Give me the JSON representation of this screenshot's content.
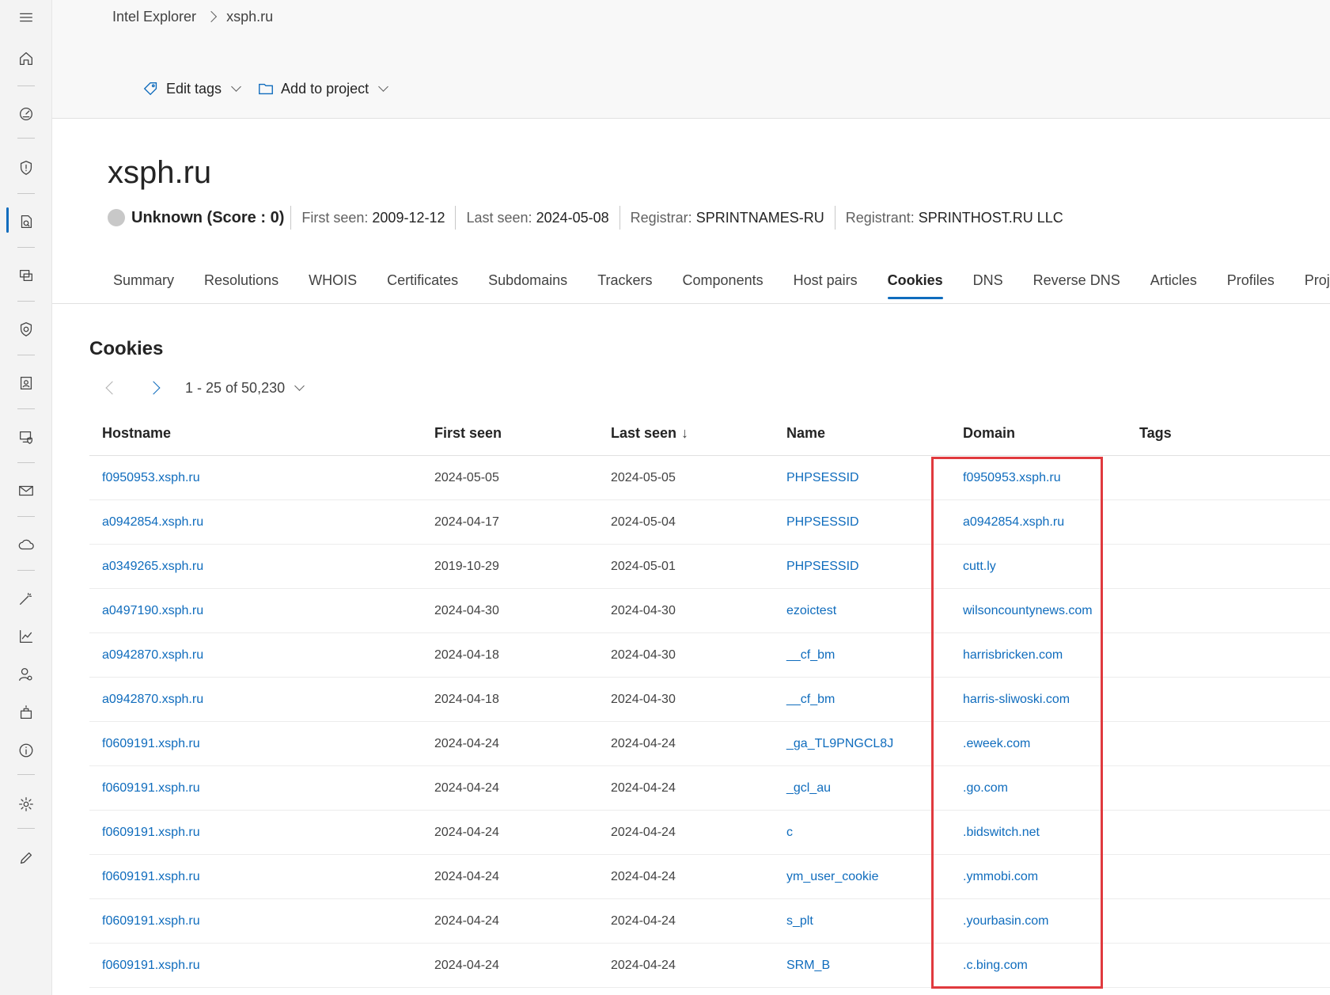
{
  "breadcrumb": {
    "root": "Intel Explorer",
    "current": "xsph.ru"
  },
  "toolbar": {
    "edit_tags": "Edit tags",
    "add_to_project": "Add to project"
  },
  "title": "xsph.ru",
  "meta": {
    "reputation": "Unknown (Score : 0)",
    "first_seen_label": "First seen:",
    "first_seen": "2009-12-12",
    "last_seen_label": "Last seen:",
    "last_seen": "2024-05-08",
    "registrar_label": "Registrar:",
    "registrar": "SPRINTNAMES-RU",
    "registrant_label": "Registrant:",
    "registrant": "SPRINTHOST.RU LLC"
  },
  "tabs": [
    "Summary",
    "Resolutions",
    "WHOIS",
    "Certificates",
    "Subdomains",
    "Trackers",
    "Components",
    "Host pairs",
    "Cookies",
    "DNS",
    "Reverse DNS",
    "Articles",
    "Profiles",
    "Projects"
  ],
  "active_tab": "Cookies",
  "section": {
    "title": "Cookies",
    "pager_text": "1 - 25 of 50,230"
  },
  "table": {
    "headers": {
      "hostname": "Hostname",
      "first_seen": "First seen",
      "last_seen": "Last seen",
      "name": "Name",
      "domain": "Domain",
      "tags": "Tags"
    },
    "sort_indicator": "↓",
    "rows": [
      {
        "hostname": "f0950953.xsph.ru",
        "first_seen": "2024-05-05",
        "last_seen": "2024-05-05",
        "name": "PHPSESSID",
        "domain": "f0950953.xsph.ru"
      },
      {
        "hostname": "a0942854.xsph.ru",
        "first_seen": "2024-04-17",
        "last_seen": "2024-05-04",
        "name": "PHPSESSID",
        "domain": "a0942854.xsph.ru"
      },
      {
        "hostname": "a0349265.xsph.ru",
        "first_seen": "2019-10-29",
        "last_seen": "2024-05-01",
        "name": "PHPSESSID",
        "domain": "cutt.ly"
      },
      {
        "hostname": "a0497190.xsph.ru",
        "first_seen": "2024-04-30",
        "last_seen": "2024-04-30",
        "name": "ezoictest",
        "domain": "wilsoncountynews.com"
      },
      {
        "hostname": "a0942870.xsph.ru",
        "first_seen": "2024-04-18",
        "last_seen": "2024-04-30",
        "name": "__cf_bm",
        "domain": "harrisbricken.com"
      },
      {
        "hostname": "a0942870.xsph.ru",
        "first_seen": "2024-04-18",
        "last_seen": "2024-04-30",
        "name": "__cf_bm",
        "domain": "harris-sliwoski.com"
      },
      {
        "hostname": "f0609191.xsph.ru",
        "first_seen": "2024-04-24",
        "last_seen": "2024-04-24",
        "name": "_ga_TL9PNGCL8J",
        "domain": ".eweek.com"
      },
      {
        "hostname": "f0609191.xsph.ru",
        "first_seen": "2024-04-24",
        "last_seen": "2024-04-24",
        "name": "_gcl_au",
        "domain": ".go.com"
      },
      {
        "hostname": "f0609191.xsph.ru",
        "first_seen": "2024-04-24",
        "last_seen": "2024-04-24",
        "name": "c",
        "domain": ".bidswitch.net"
      },
      {
        "hostname": "f0609191.xsph.ru",
        "first_seen": "2024-04-24",
        "last_seen": "2024-04-24",
        "name": "ym_user_cookie",
        "domain": ".ymmobi.com"
      },
      {
        "hostname": "f0609191.xsph.ru",
        "first_seen": "2024-04-24",
        "last_seen": "2024-04-24",
        "name": "s_plt",
        "domain": ".yourbasin.com"
      },
      {
        "hostname": "f0609191.xsph.ru",
        "first_seen": "2024-04-24",
        "last_seen": "2024-04-24",
        "name": "SRM_B",
        "domain": ".c.bing.com"
      }
    ]
  },
  "colors": {
    "accent": "#0f6cbd",
    "highlight": "#e03a3e",
    "unknown_dot": "#c8c8c8"
  }
}
